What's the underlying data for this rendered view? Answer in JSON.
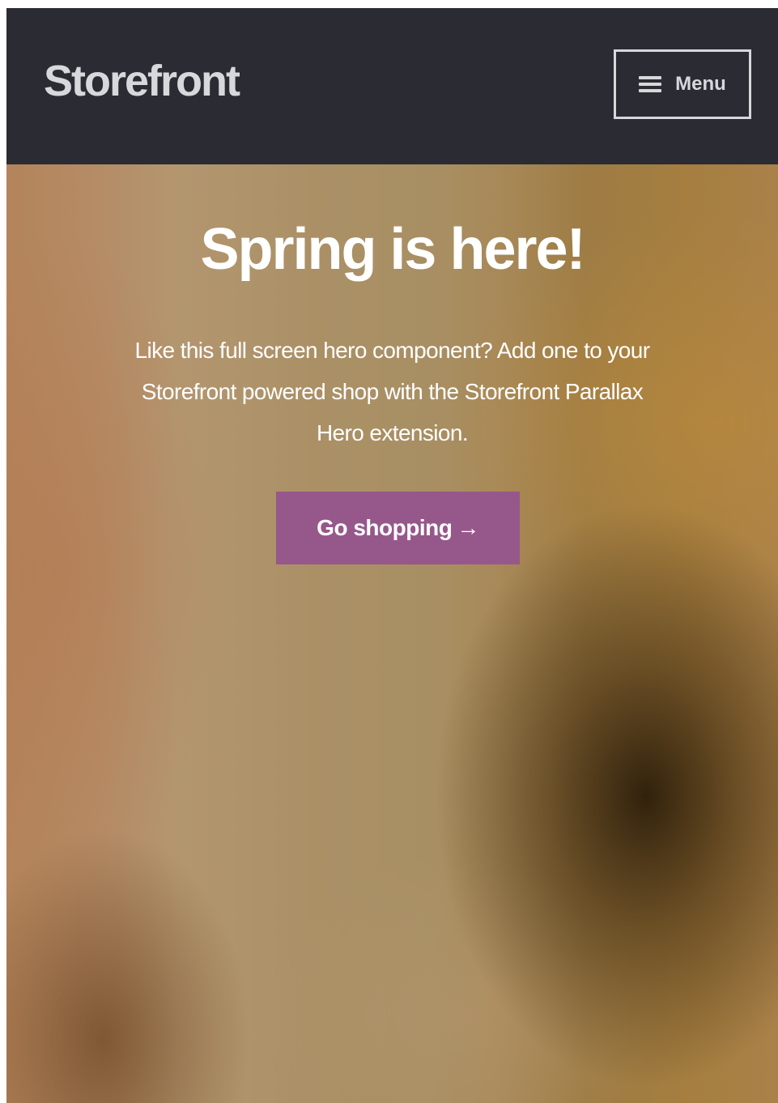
{
  "header": {
    "site_title": "Storefront",
    "menu_label": "Menu",
    "menu_icon": "hamburger-icon",
    "background_color": "#2b2c33",
    "text_color": "#d6d8dc"
  },
  "hero": {
    "title": "Spring is here!",
    "description": "Like this full screen hero component? Add one to your Storefront powered shop with the Storefront Parallax Hero extension.",
    "button_label": "Go shopping",
    "button_arrow": "→",
    "button_color": "#96588a",
    "text_color": "#ffffff"
  }
}
